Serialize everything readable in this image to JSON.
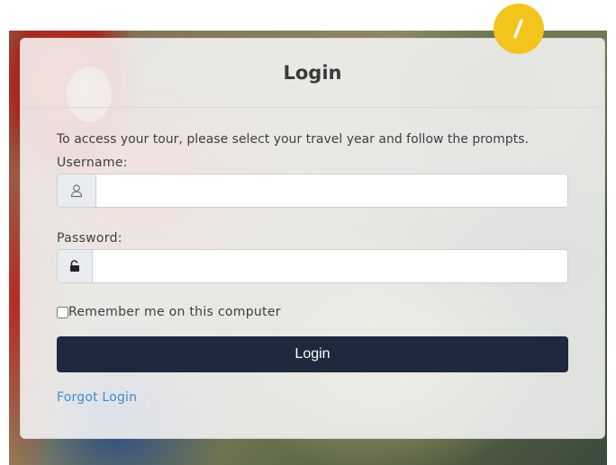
{
  "login_card": {
    "title": "Login",
    "intro_text": "To access your tour, please select your travel year and follow the prompts.",
    "username_label": "Username:",
    "username_value": "",
    "password_label": "Password:",
    "password_value": "",
    "remember_label": "Remember me on this computer",
    "remember_checked": false,
    "login_button_label": "Login",
    "forgot_link_label": "Forgot Login"
  },
  "icons": {
    "username_icon": "user-icon",
    "password_icon": "unlock-icon",
    "badge_icon": "pencil-slash-icon"
  },
  "colors": {
    "primary_button": "#1e293e",
    "link": "#3c8ed0",
    "badge": "#f3c41a"
  }
}
